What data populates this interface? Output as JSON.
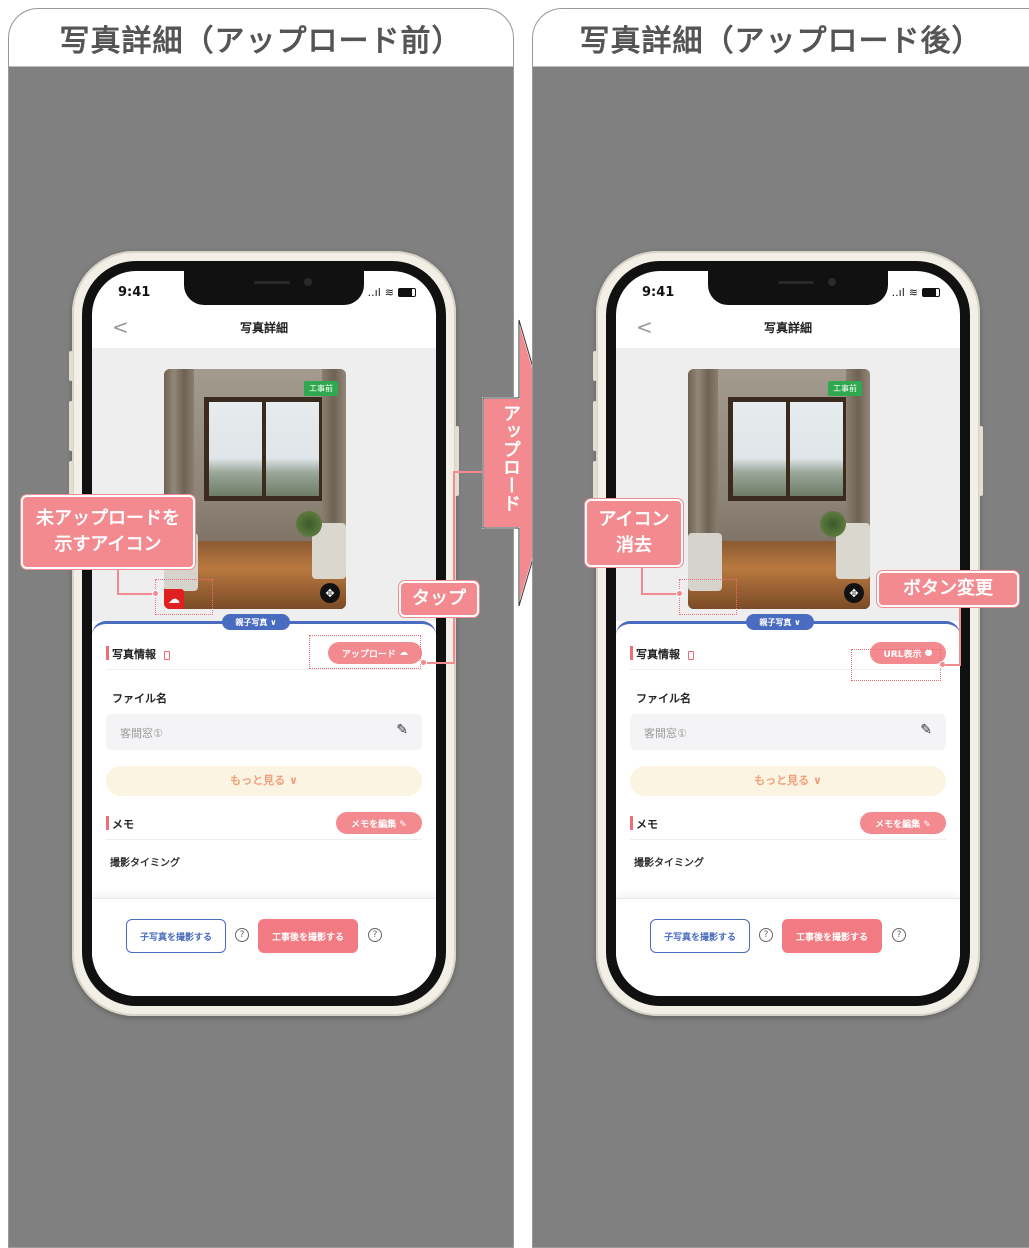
{
  "left": {
    "heading": "写真詳細（アップロード前）",
    "upload_label": "アップロード",
    "callout_main": "未アップロードを\n示すアイコン",
    "callout_tap": "タップ"
  },
  "right": {
    "heading": "写真詳細（アップロード後）",
    "url_label": "URL表示",
    "callout_removed": "アイコン\n消去",
    "callout_button": "ボタン変更"
  },
  "arrow_text": "アップロード",
  "phone": {
    "time": "9:41",
    "nav_title": "写真詳細",
    "back": "<",
    "photo_tag": "工事前",
    "parent_tab": "親子写真 ∨",
    "section_info": "写真情報",
    "file_label": "ファイル名",
    "file_value": "客間窓①",
    "more": "もっと見る ∨",
    "memo_label": "メモ",
    "memo_button": "メモを編集 ✎",
    "partial_label": "撮影タイミング",
    "child_button": "子写真を撮影する",
    "after_button": "工事後を撮影する",
    "help": "?",
    "signal": "..ıl",
    "wifi": "≋"
  },
  "colors": {
    "accent_pink": "#f38a8f",
    "accent_blue": "#4a6cc0",
    "tag_green": "#2fa84f",
    "panel_gray": "#808080"
  }
}
